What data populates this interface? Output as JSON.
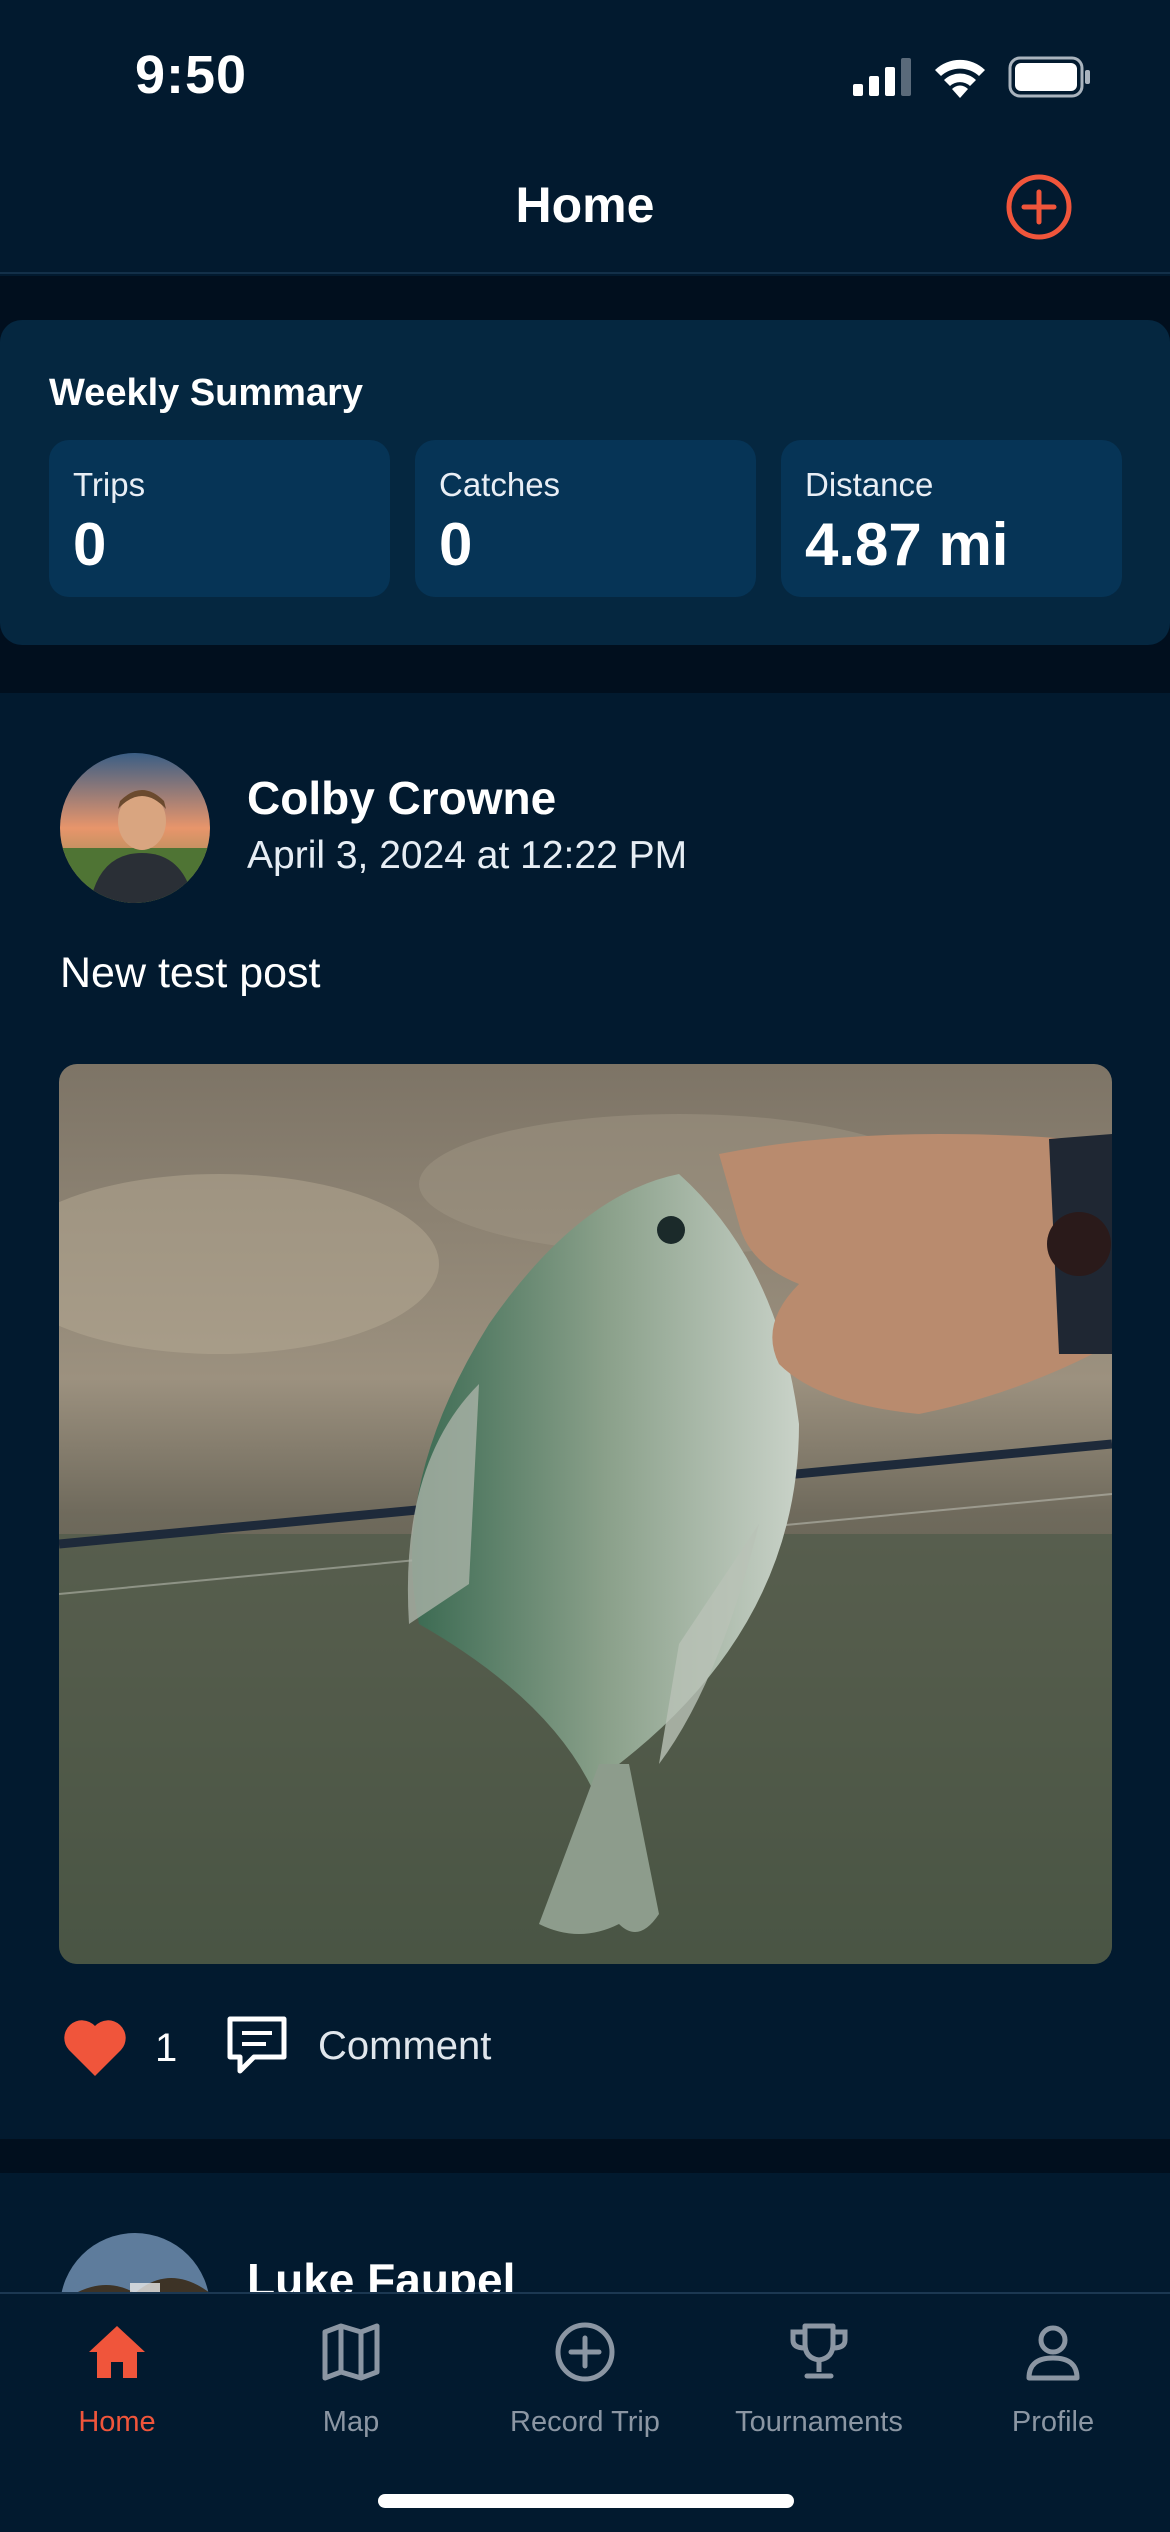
{
  "status_bar": {
    "time": "9:50"
  },
  "nav": {
    "title": "Home",
    "add_icon": "plus-circle-icon"
  },
  "summary": {
    "title": "Weekly Summary",
    "stats": [
      {
        "label": "Trips",
        "value": "0"
      },
      {
        "label": "Catches",
        "value": "0"
      },
      {
        "label": "Distance",
        "value": "4.87 mi"
      }
    ]
  },
  "post": {
    "author": "Colby Crowne",
    "date": "April 3, 2024 at 12:22 PM",
    "text": "New test post",
    "likes": "1",
    "comment_label": "Comment"
  },
  "next_post": {
    "author": "Luke Faupel"
  },
  "tabs": [
    {
      "label": "Home",
      "icon": "home-icon",
      "active": true
    },
    {
      "label": "Map",
      "icon": "map-icon",
      "active": false
    },
    {
      "label": "Record Trip",
      "icon": "plus-circle-icon",
      "active": false
    },
    {
      "label": "Tournaments",
      "icon": "trophy-icon",
      "active": false
    },
    {
      "label": "Profile",
      "icon": "person-icon",
      "active": false
    }
  ],
  "colors": {
    "background": "#021a2f",
    "card": "#052740",
    "tile": "#063456",
    "accent": "#f0553b",
    "inactive": "#8b96a3"
  }
}
